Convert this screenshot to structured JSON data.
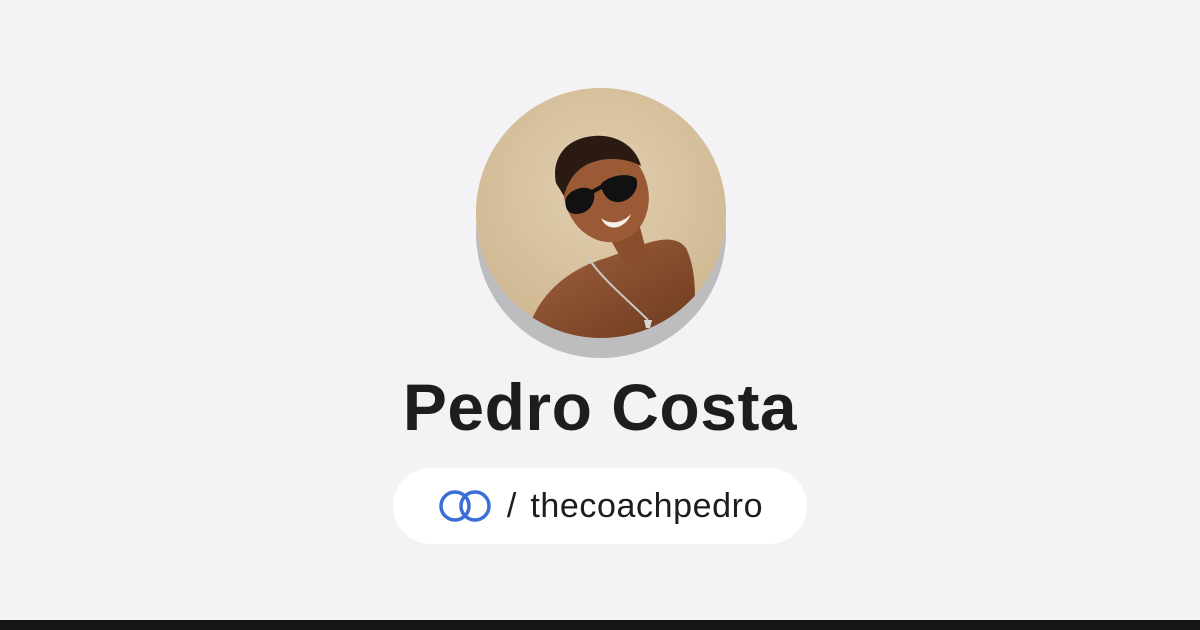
{
  "profile": {
    "name": "Pedro Costa",
    "avatar_alt": "profile-photo",
    "separator": "/",
    "handle": "thecoachpedro",
    "link_icon": "linked-rings-icon"
  },
  "colors": {
    "background": "#f3f3f6",
    "text": "#1d1d1f",
    "accent": "#3a6fd8",
    "pill": "#ffffff",
    "avatar_shadow": "#bdbdc0",
    "bottom_bar": "#161618"
  }
}
